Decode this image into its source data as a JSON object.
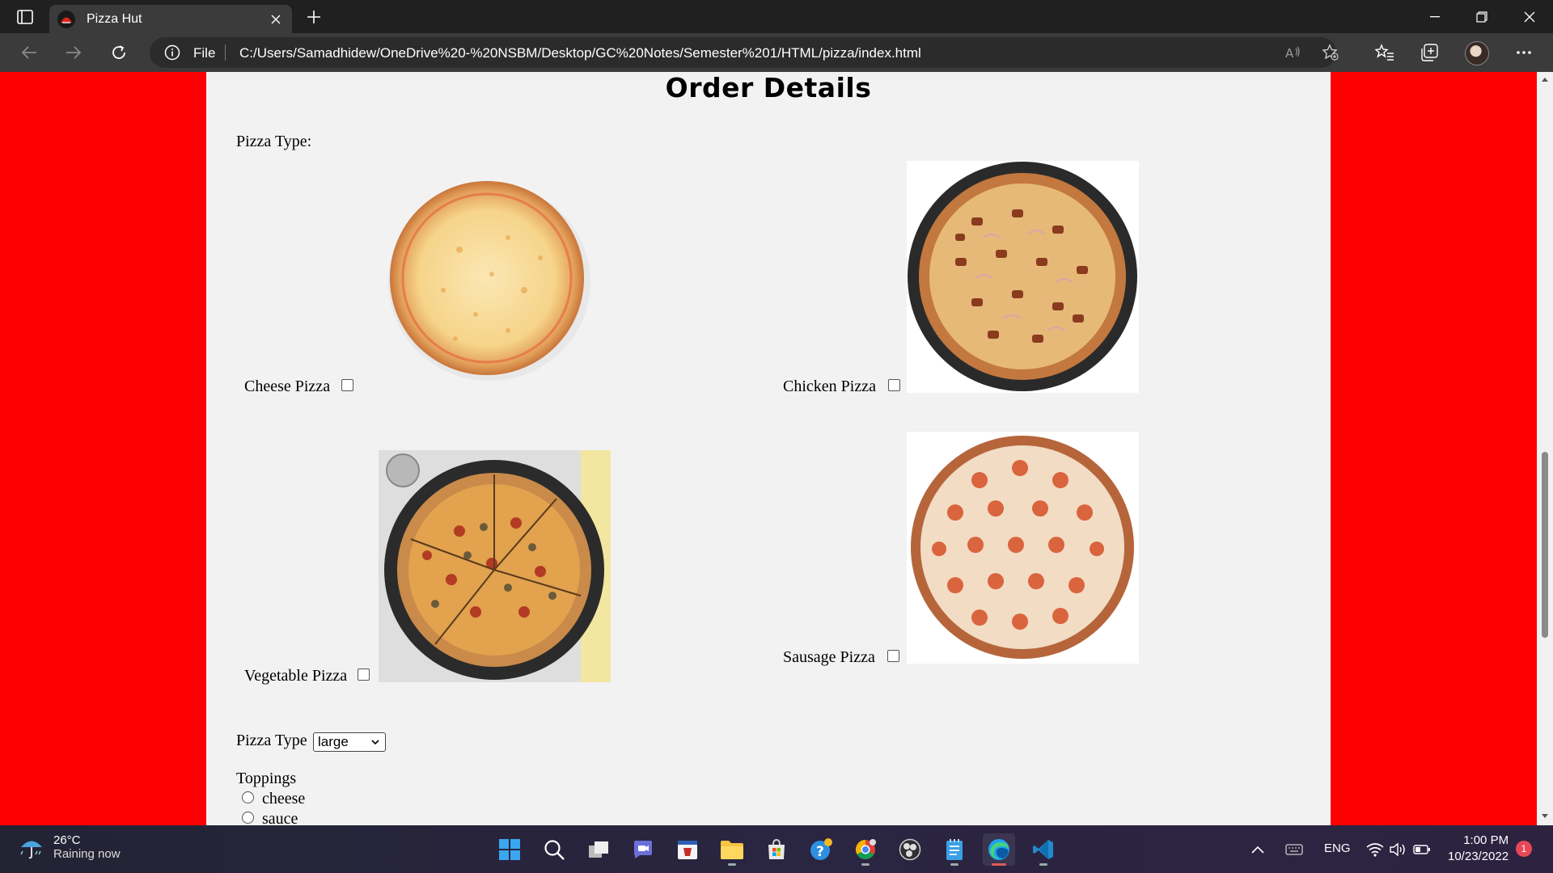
{
  "browser": {
    "tab_title": "Pizza Hut",
    "address_scheme": "File",
    "address_url": "C:/Users/Samadhidew/OneDrive%20-%20NSBM/Desktop/GC%20Notes/Semester%201/HTML/pizza/index.html"
  },
  "page": {
    "heading": "Order Details",
    "pizza_type_label": "Pizza Type:",
    "pizzas": [
      {
        "name": "Cheese Pizza",
        "checked": false
      },
      {
        "name": "Chicken Pizza",
        "checked": false
      },
      {
        "name": "Vegetable Pizza",
        "checked": false
      },
      {
        "name": "Sausage Pizza",
        "checked": false
      }
    ],
    "size_label": "Pizza Type",
    "size_selected": "large",
    "toppings_label": "Toppings",
    "toppings": [
      "cheese",
      "sauce"
    ]
  },
  "taskbar": {
    "weather_temp": "26°C",
    "weather_desc": "Raining now",
    "language": "ENG",
    "time": "1:00 PM",
    "date": "10/23/2022",
    "notification_count": "1"
  },
  "colors": {
    "page_background": "#ff0000",
    "content_background": "#f2f2f2",
    "browser_chrome": "#3b3b3b"
  }
}
